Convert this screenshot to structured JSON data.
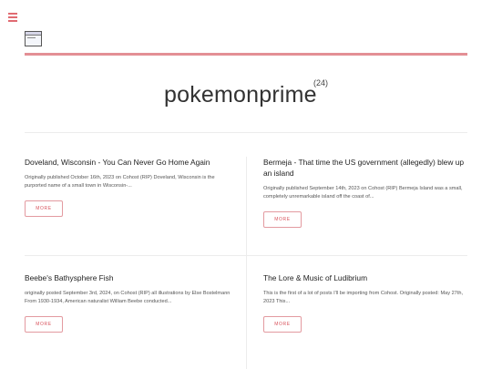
{
  "header": {
    "menu_icon": "hamburger-menu-icon",
    "logo_icon": "blog-logo-image",
    "accent_color": "#e38f95"
  },
  "blog": {
    "title": "pokemonprime",
    "post_count": "(24)"
  },
  "posts": [
    {
      "title": "Doveland, Wisconsin - You Can Never Go Home Again",
      "excerpt": "Originally published October 16th, 2023 on Cohost (RIP) Doveland, Wisconsin is the purported name of a small town in Wisconsin-...",
      "more_label": "MORE"
    },
    {
      "title": "Bermeja - That time the US government (allegedly) blew up an island",
      "excerpt": "Originally published September 14th, 2023 on Cohost (RIP) Bermeja Island was a small, completely unremarkable island off the coast of...",
      "more_label": "MORE"
    },
    {
      "title": "Beebe's Bathysphere Fish",
      "excerpt": "originally posted September 3rd, 2024, on Cohost (RIP) all illustrations by Else Bostelmann From 1930-1934, American naturalist William Beebe conducted...",
      "more_label": "MORE"
    },
    {
      "title": "The Lore & Music of Ludibrium",
      "excerpt": "This is the first of a lot of posts I'll be importing from Cohost. Originally posted: May 27th, 2023 This...",
      "more_label": "MORE"
    }
  ]
}
